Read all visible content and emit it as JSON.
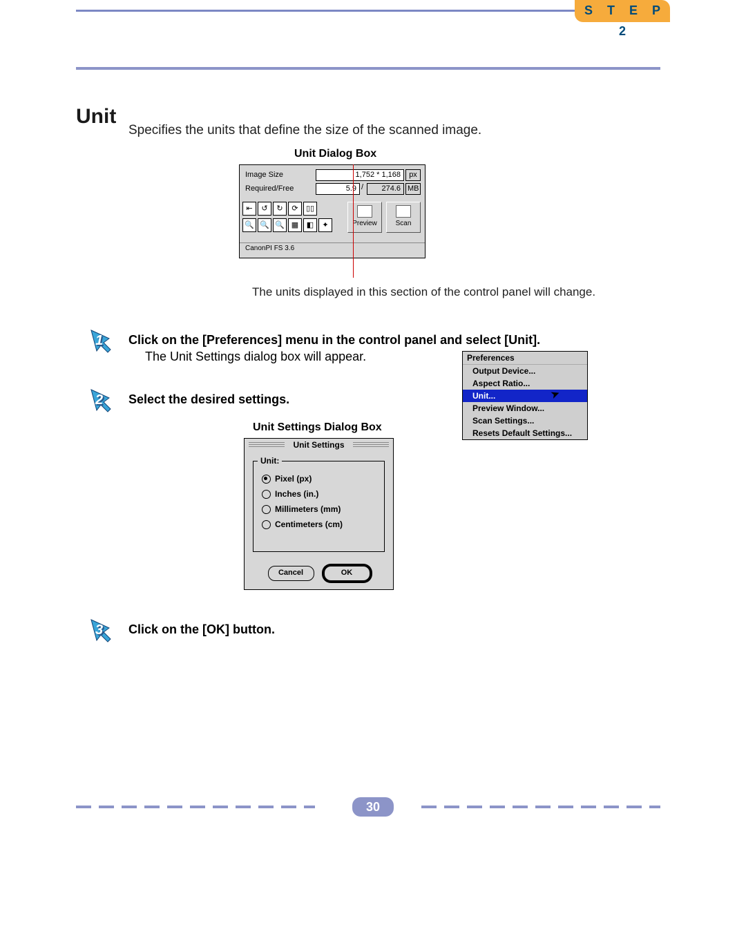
{
  "header": {
    "step_label": "S T E P  2"
  },
  "title": "Unit",
  "intro": "Specifies the units that define the size of the scanned image.",
  "unit_dialog": {
    "caption": "Unit Dialog Box",
    "image_size_label": "Image Size",
    "image_size_value": "1,752 * 1,168",
    "image_size_unit": "px",
    "required_free_label": "Required/Free",
    "required_value": "5.9",
    "free_value": "274.6",
    "required_free_unit": "MB",
    "preview_label": "Preview",
    "scan_label": "Scan",
    "status_text": "CanonPI FS 3.6",
    "note": "The units displayed in this section of the control panel will change."
  },
  "steps": [
    {
      "num": "1",
      "bold": "Click on the [Preferences] menu in the control panel and select [Unit].",
      "detail": "The Unit Settings dialog box will appear."
    },
    {
      "num": "2",
      "bold": "Select the desired settings."
    },
    {
      "num": "3",
      "bold": "Click on the [OK] button."
    }
  ],
  "preferences_menu": {
    "title": "Preferences",
    "items": [
      "Output Device...",
      "Aspect Ratio...",
      "Unit...",
      "Preview Window...",
      "Scan Settings...",
      "Resets Default Settings..."
    ],
    "selected_index": 2
  },
  "unit_settings": {
    "caption": "Unit Settings Dialog Box",
    "title": "Unit Settings",
    "group_label": "Unit:",
    "options": [
      "Pixel (px)",
      "Inches (in.)",
      "Millimeters (mm)",
      "Centimeters (cm)"
    ],
    "selected_index": 0,
    "cancel": "Cancel",
    "ok": "OK"
  },
  "page_number": "30"
}
